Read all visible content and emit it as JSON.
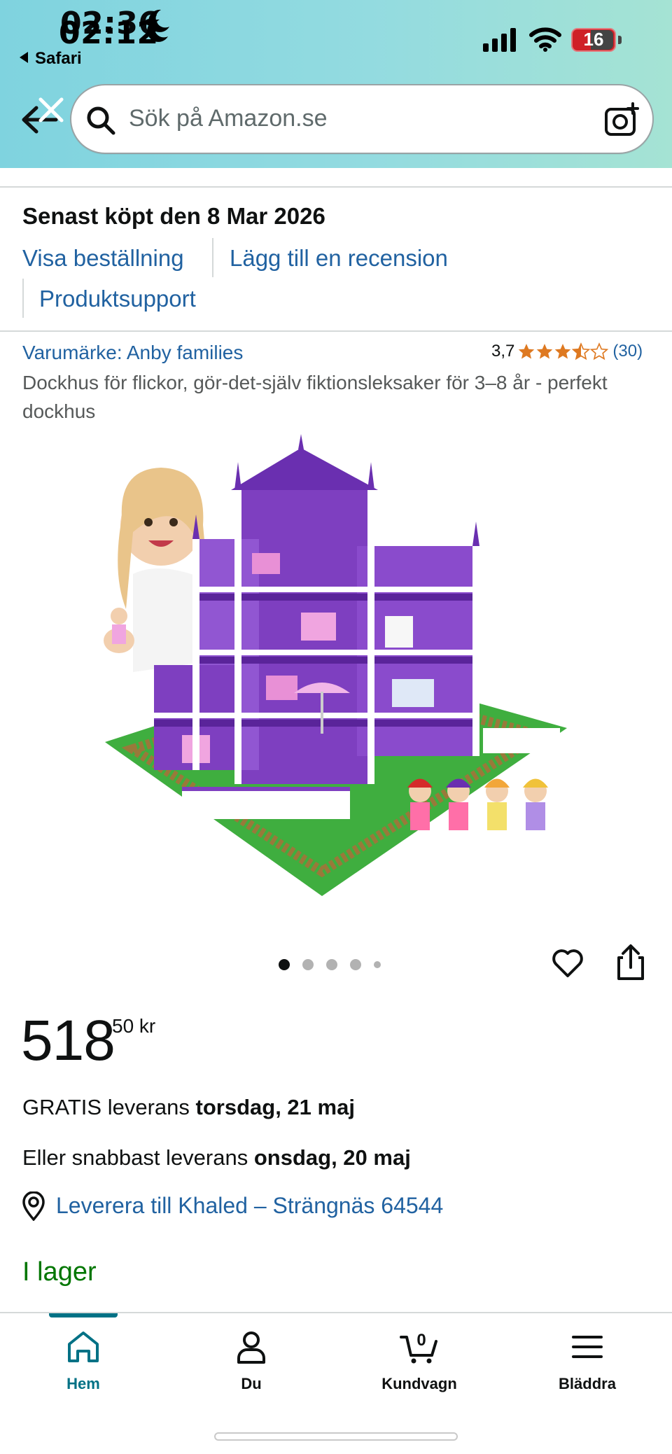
{
  "status_bar": {
    "time_front": "02:12",
    "time_back": "02:36",
    "back_app": "Safari",
    "battery": "16",
    "icons": [
      "moon-icon",
      "signal-icon",
      "wifi-icon",
      "battery-icon"
    ]
  },
  "search": {
    "placeholder": "Sök på Amazon.se",
    "icons": [
      "back-arrow-icon",
      "close-icon",
      "search-icon",
      "camera-icon"
    ]
  },
  "order": {
    "bought_label": "Senast köpt den 8 Mar 2026",
    "view_order": "Visa beställning",
    "add_review": "Lägg till en recension",
    "support": "Produktsupport"
  },
  "product": {
    "brand": "Varumärke: Anby families",
    "rating": "3,7",
    "rating_value": 3.7,
    "rating_count": "(30)",
    "title": "Dockhus för flickor, gör-det-själv fiktionsleksaker för 3–8 år - perfekt dockhus",
    "image_count": 5,
    "active_image": 1,
    "price_whole": "518",
    "price_fraction": "50 kr",
    "free_delivery_prefix": "GRATIS leverans ",
    "free_delivery_date": "torsdag, 21 maj",
    "fast_delivery_prefix": "Eller snabbast leverans ",
    "fast_delivery_date": "onsdag, 20 maj",
    "deliver_to": "Leverera till Khaled – Strängnäs 64544",
    "stock": "I lager"
  },
  "tabs": [
    {
      "label": "Hem",
      "icon": "home-icon",
      "active": true
    },
    {
      "label": "Du",
      "icon": "person-icon",
      "active": false
    },
    {
      "label": "Kundvagn",
      "icon": "cart-icon",
      "active": false,
      "badge": "0"
    },
    {
      "label": "Bläddra",
      "icon": "menu-icon",
      "active": false
    }
  ],
  "colors": {
    "link": "#2162a1",
    "in_stock": "#007600",
    "active_tab": "#007185",
    "star": "#de7921"
  }
}
